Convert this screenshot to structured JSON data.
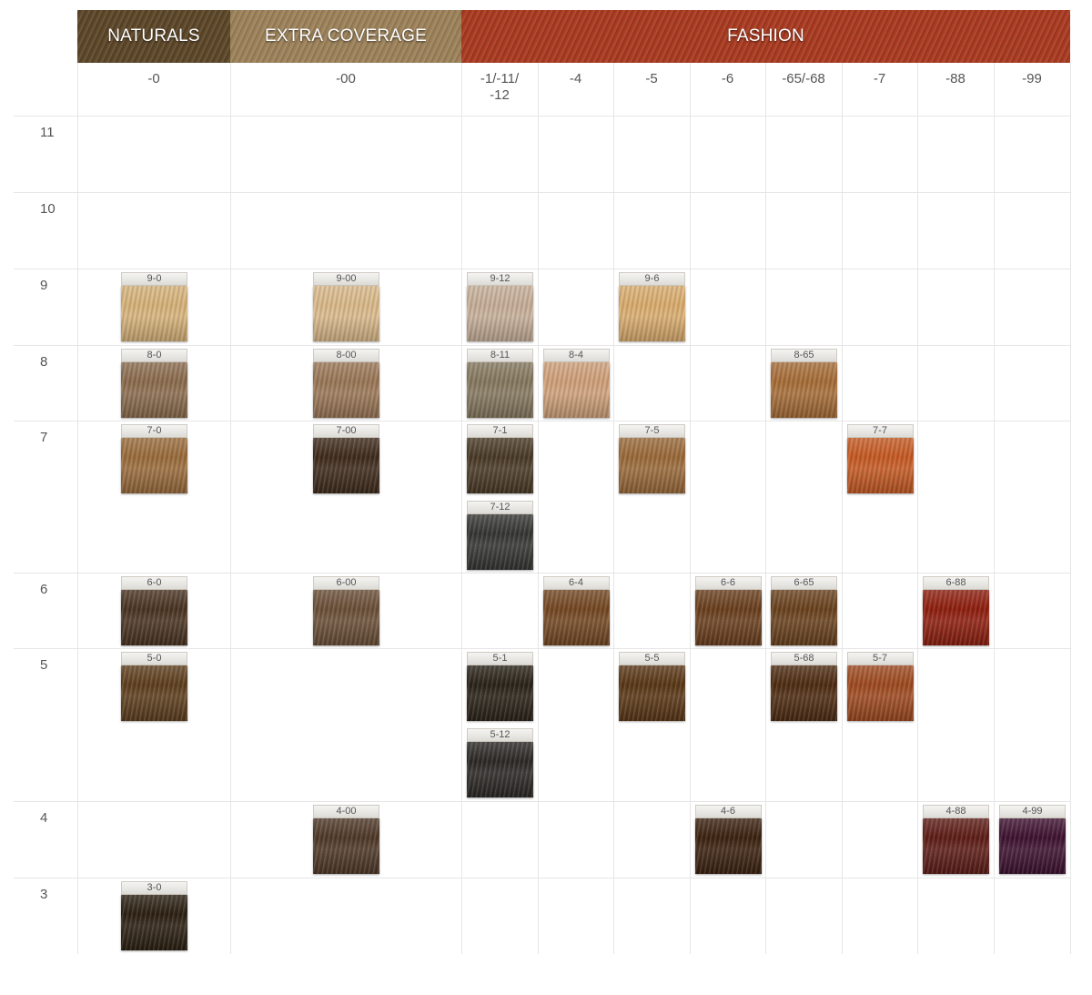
{
  "chart_data": {
    "type": "table",
    "groups": [
      {
        "name": "NATURALS",
        "color": "#5b4527"
      },
      {
        "name": "EXTRA COVERAGE",
        "color": "#9c8159"
      },
      {
        "name": "FASHION",
        "color": "#a8391f"
      }
    ],
    "columns": [
      "-0",
      "-00",
      "-1/-11/\n-12",
      "-4",
      "-5",
      "-6",
      "-65/-68",
      "-7",
      "-88",
      "-99"
    ],
    "rows": [
      "11",
      "10",
      "9",
      "8",
      "7",
      "6",
      "5",
      "4",
      "3"
    ],
    "shades": [
      {
        "label": "9-0",
        "color": "#d6b27a"
      },
      {
        "label": "9-00",
        "color": "#d9b98a"
      },
      {
        "label": "9-12",
        "color": "#c6ae98"
      },
      {
        "label": "9-6",
        "color": "#d9ac6e"
      },
      {
        "label": "8-0",
        "color": "#8b6c4e"
      },
      {
        "label": "8-00",
        "color": "#9a7757"
      },
      {
        "label": "8-11",
        "color": "#85785f"
      },
      {
        "label": "8-4",
        "color": "#cfa07a"
      },
      {
        "label": "8-65",
        "color": "#a66d38"
      },
      {
        "label": "7-0",
        "color": "#9a6c3c"
      },
      {
        "label": "7-00",
        "color": "#3f2b1c"
      },
      {
        "label": "7-1",
        "color": "#4a3a26"
      },
      {
        "label": "7-5",
        "color": "#9a6a3a"
      },
      {
        "label": "7-7",
        "color": "#c55a24"
      },
      {
        "label": "7-12",
        "color": "#363634"
      },
      {
        "label": "6-0",
        "color": "#4a3422"
      },
      {
        "label": "6-00",
        "color": "#6b5038"
      },
      {
        "label": "6-4",
        "color": "#744823"
      },
      {
        "label": "6-6",
        "color": "#6a3f1e"
      },
      {
        "label": "6-65",
        "color": "#6a421e"
      },
      {
        "label": "6-88",
        "color": "#8e1f0f"
      },
      {
        "label": "5-0",
        "color": "#5e3f1e"
      },
      {
        "label": "5-1",
        "color": "#2a2318"
      },
      {
        "label": "5-5",
        "color": "#5a3716"
      },
      {
        "label": "5-68",
        "color": "#4e2c12"
      },
      {
        "label": "5-7",
        "color": "#9e4a20"
      },
      {
        "label": "5-12",
        "color": "#2c2926"
      },
      {
        "label": "4-00",
        "color": "#4f3928"
      },
      {
        "label": "4-6",
        "color": "#3c2210"
      },
      {
        "label": "4-88",
        "color": "#5e1d17"
      },
      {
        "label": "4-99",
        "color": "#3e1230"
      },
      {
        "label": "3-0",
        "color": "#2c2012"
      }
    ]
  }
}
